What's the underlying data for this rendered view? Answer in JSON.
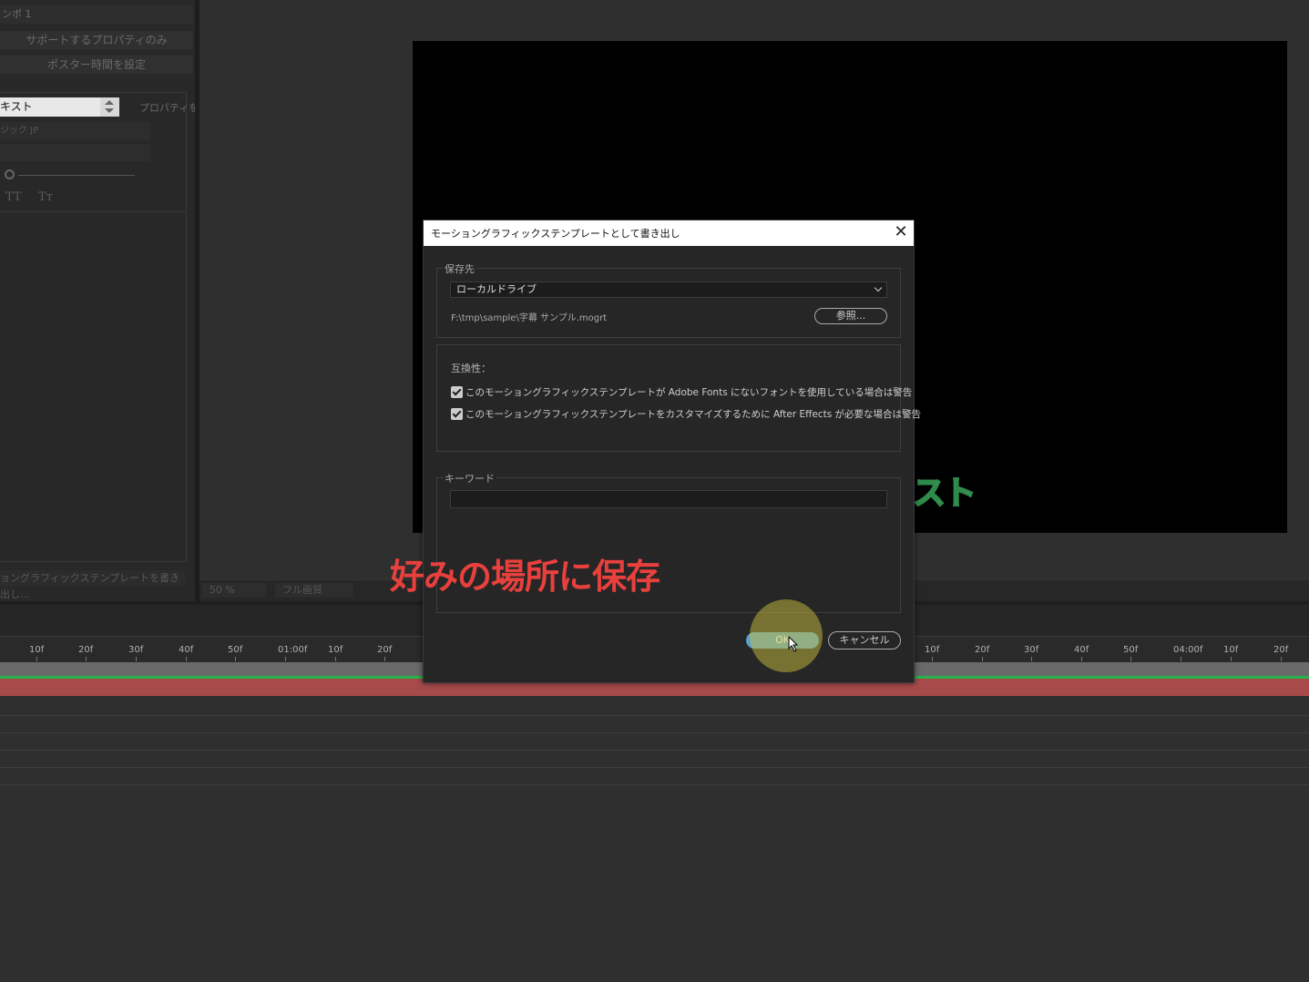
{
  "left_panel": {
    "comp_dropdown": "ンポ 1",
    "btn_supported_props": "サポートするプロパティのみ",
    "btn_poster_time": "ポスター時間を設定",
    "text_field": "キスト",
    "properties_label": "プロパティを",
    "font_select": "ジック JP",
    "tt_label": "TT",
    "tr_label": "Tт",
    "export_button": "ョングラフィックステンプレートを書き出し..."
  },
  "viewer": {
    "overlay_text": "スト",
    "zoom": "50 %",
    "quality": "フル画質"
  },
  "timeline": {
    "ticks": [
      "10f",
      "20f",
      "30f",
      "40f",
      "50f",
      "01:00f",
      "10f",
      "20f",
      "10f",
      "20f",
      "30f",
      "40f",
      "50f",
      "04:00f",
      "10f",
      "20f"
    ]
  },
  "dialog": {
    "title": "モーショングラフィックステンプレートとして書き出し",
    "destination_label": "保存先",
    "destination_value": "ローカルドライブ",
    "path": "F:\\tmp\\sample\\字幕 サンプル.mogrt",
    "browse_button": "参照...",
    "compat_label": "互換性：",
    "checkbox1": "このモーショングラフィックステンプレートが Adobe  Fonts にないフォントを使用している場合は警告",
    "checkbox2": "このモーショングラフィックステンプレートをカスタマイズするために After  Effects が必要な場合は警告",
    "keyword_label": "キーワード",
    "ok_button": "OK",
    "cancel_button": "キャンセル"
  },
  "annotation": "好みの場所に保存",
  "colors": {
    "accent": "#5aa0c8",
    "annotation": "#e8403d",
    "layer_bar": "#a64a4a",
    "work_area": "#29b34a"
  }
}
